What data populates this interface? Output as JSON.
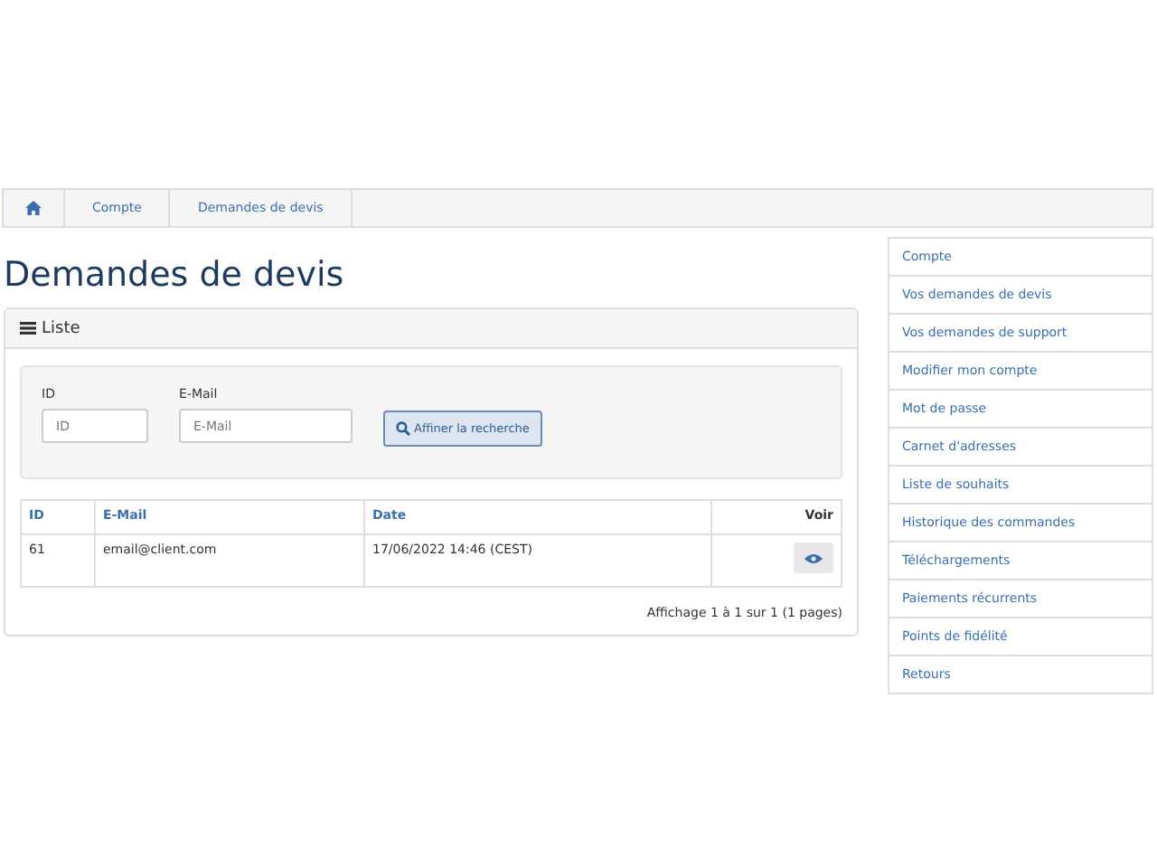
{
  "breadcrumb": [
    {
      "label": "Compte"
    },
    {
      "label": "Demandes de devis"
    }
  ],
  "page_title": "Demandes de devis",
  "panel": {
    "title": "Liste",
    "filters": [
      {
        "label": "ID",
        "placeholder": "ID"
      },
      {
        "label": "E-Mail",
        "placeholder": "E-Mail"
      }
    ],
    "search_button": "Affiner la recherche",
    "table": {
      "columns": [
        "ID",
        "E-Mail",
        "Date",
        "Voir"
      ],
      "rows": [
        {
          "id": "61",
          "email": "email@client.com",
          "date": "17/06/2022 14:46 (CEST)"
        }
      ]
    },
    "pagination": "Affichage 1 à 1 sur 1 (1 pages)"
  },
  "sidebar": {
    "items": [
      {
        "label": "Compte"
      },
      {
        "label": "Vos demandes de devis"
      },
      {
        "label": "Vos demandes de support"
      },
      {
        "label": "Modifier mon compte"
      },
      {
        "label": "Mot de passe"
      },
      {
        "label": "Carnet d'adresses"
      },
      {
        "label": "Liste de souhaits"
      },
      {
        "label": "Historique des commandes"
      },
      {
        "label": "Téléchargements"
      },
      {
        "label": "Paiements récurrents"
      },
      {
        "label": "Points de fidélité"
      },
      {
        "label": "Retours"
      }
    ]
  }
}
